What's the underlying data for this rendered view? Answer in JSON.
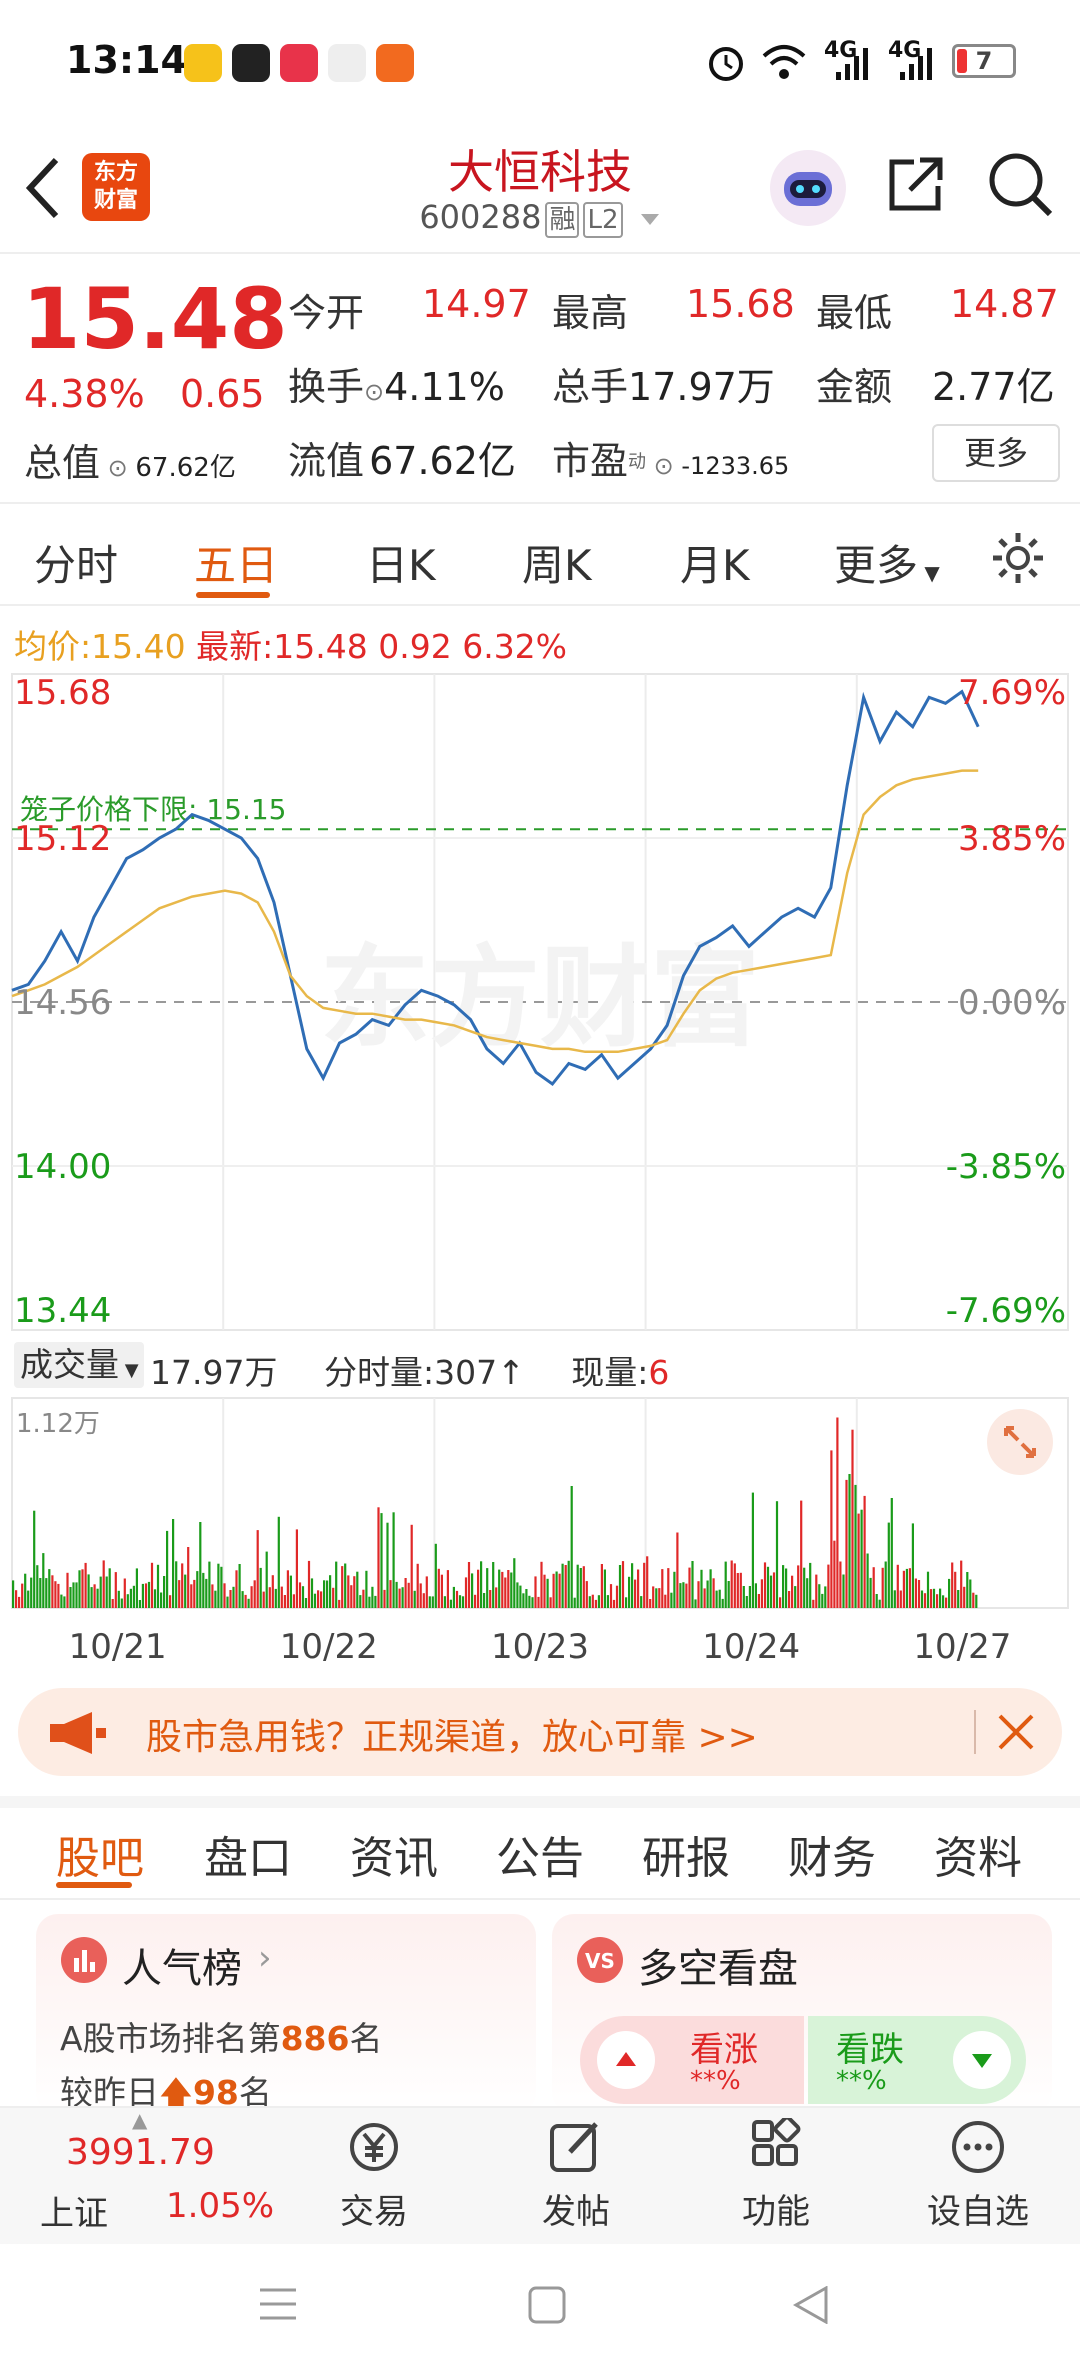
{
  "status_bar": {
    "time": "13:14",
    "net1": "4G",
    "net2": "4G",
    "battery": "7"
  },
  "header": {
    "logo_text": "东方\n财富",
    "stock_name": "大恒科技",
    "stock_code": "600288",
    "tag_margin": "融",
    "tag_level": "L2"
  },
  "quote": {
    "price": "15.48",
    "change_pct": "4.38%",
    "change_amt": "0.65",
    "open_label": "今开",
    "open": "14.97",
    "high_label": "最高",
    "high": "15.68",
    "low_label": "最低",
    "low": "14.87",
    "turnover_label": "换手",
    "turnover": "4.11%",
    "volume_label": "总手",
    "volume": "17.97万",
    "amount_label": "金额",
    "amount": "2.77亿",
    "mcap_label": "总值",
    "mcap": "67.62亿",
    "float_label": "流值",
    "float_cap": "67.62亿",
    "pe_label": "市盈",
    "pe_sup": "动",
    "pe": "-1233.65",
    "more": "更多"
  },
  "chart_tabs": [
    "分时",
    "五日",
    "日K",
    "周K",
    "月K",
    "更多"
  ],
  "active_chart_tab": "五日",
  "info_line": {
    "avg_label": "均价:",
    "avg": "15.40",
    "latest_label": "最新:",
    "latest": "15.48",
    "chg": "0.92",
    "chg_pct": "6.32%"
  },
  "volume_header": {
    "label": "成交量",
    "total": "17.97万",
    "tick_label": "分时量:",
    "tick": "307↑",
    "now_label": "现量:",
    "now": "6"
  },
  "chart_data": {
    "type": "line",
    "price_axis_left": [
      "15.68",
      "15.12",
      "14.56",
      "14.00",
      "13.44"
    ],
    "price_axis_right": [
      "7.69%",
      "3.85%",
      "0.00%",
      "-3.85%",
      "-7.69%"
    ],
    "ylim": [
      13.44,
      15.68
    ],
    "prev_close": 14.56,
    "cage_label": "笼子价格下限:",
    "cage_value": "15.15",
    "x_dates": [
      "10/21",
      "10/22",
      "10/23",
      "10/24",
      "10/27"
    ],
    "volume_max_label": "1.12万",
    "watermark": "东方财富",
    "series": [
      {
        "name": "price",
        "color": "#2f6db5",
        "values": [
          14.6,
          14.62,
          14.7,
          14.8,
          14.7,
          14.85,
          14.95,
          15.05,
          15.08,
          15.12,
          15.15,
          15.2,
          15.18,
          15.15,
          15.12,
          15.05,
          14.9,
          14.65,
          14.4,
          14.3,
          14.42,
          14.45,
          14.5,
          14.48,
          14.55,
          14.6,
          14.58,
          14.55,
          14.5,
          14.4,
          14.35,
          14.42,
          14.32,
          14.28,
          14.35,
          14.33,
          14.38,
          14.3,
          14.35,
          14.4,
          14.48,
          14.65,
          14.75,
          14.78,
          14.82,
          14.75,
          14.8,
          14.85,
          14.88,
          14.85,
          14.95,
          15.3,
          15.6,
          15.45,
          15.55,
          15.5,
          15.6,
          15.58,
          15.62,
          15.5
        ]
      },
      {
        "name": "avg",
        "color": "#e8b84a",
        "values": [
          14.58,
          14.6,
          14.62,
          14.65,
          14.68,
          14.72,
          14.76,
          14.8,
          14.84,
          14.88,
          14.9,
          14.92,
          14.93,
          14.94,
          14.93,
          14.9,
          14.8,
          14.65,
          14.58,
          14.54,
          14.53,
          14.52,
          14.52,
          14.51,
          14.5,
          14.5,
          14.49,
          14.48,
          14.46,
          14.44,
          14.43,
          14.42,
          14.41,
          14.4,
          14.4,
          14.39,
          14.39,
          14.39,
          14.4,
          14.41,
          14.43,
          14.52,
          14.6,
          14.64,
          14.66,
          14.67,
          14.68,
          14.69,
          14.7,
          14.71,
          14.72,
          15.0,
          15.2,
          15.26,
          15.3,
          15.32,
          15.33,
          15.34,
          15.35,
          15.35
        ]
      }
    ]
  },
  "banner": {
    "text": "股市急用钱？正规渠道，放心可靠 >>"
  },
  "sub_tabs": [
    "股吧",
    "盘口",
    "资讯",
    "公告",
    "研报",
    "财务",
    "资料"
  ],
  "active_sub_tab": "股吧",
  "cards": {
    "rank_title": "人气榜",
    "rank_line1_pre": "A股市场排名第",
    "rank_line1_num": "886",
    "rank_line1_post": "名",
    "rank_line2_pre": "较昨日",
    "rank_line2_num": "98",
    "rank_line2_post": "名",
    "vs_title": "多空看盘",
    "bull_label": "看涨",
    "bull_val": "**%",
    "bear_label": "看跌",
    "bear_val": "**%"
  },
  "bottom_nav": {
    "index_value": "3991.79",
    "index_name": "上证",
    "index_chg": "1.05%",
    "items": [
      "交易",
      "发帖",
      "功能",
      "设自选"
    ]
  },
  "colors": {
    "up": "#e02828",
    "down": "#1a9b1a",
    "accent": "#e05a10",
    "line": "#2f6db5",
    "avg": "#e8b84a"
  }
}
